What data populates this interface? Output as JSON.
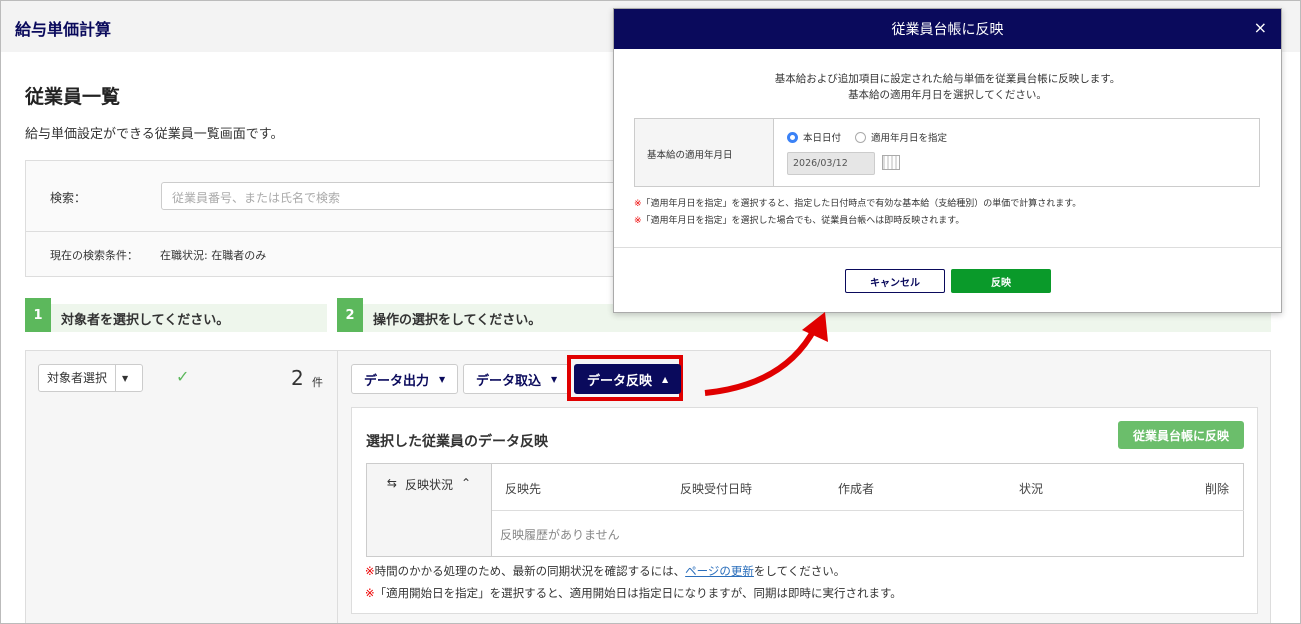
{
  "app_title": "給与単価計算",
  "page": {
    "title": "従業員一覧",
    "description": "給与単価設定ができる従業員一覧画面です。"
  },
  "search": {
    "label": "検索：",
    "placeholder": "従業員番号、または氏名で検索",
    "condition_label": "現在の検索条件：",
    "condition_value": "在職状況: 在職者のみ"
  },
  "steps": [
    {
      "num": "1",
      "label": "対象者を選択してください。"
    },
    {
      "num": "2",
      "label": "操作の選択をしてください。"
    }
  ],
  "selector": {
    "label": "対象者選択",
    "count": "2",
    "unit": "件"
  },
  "actions": [
    {
      "label": "データ出力"
    },
    {
      "label": "データ取込"
    },
    {
      "label": "データ反映"
    }
  ],
  "reflect": {
    "title": "選択した従業員のデータ反映",
    "button": "従業員台帳に反映",
    "status_toggle": "反映状況",
    "columns": [
      "反映先",
      "反映受付日時",
      "作成者",
      "状況",
      "削除"
    ],
    "empty": "反映履歴がありません",
    "note1_pre": "時間のかかる処理のため、最新の同期状況を確認するには、",
    "note1_link": "ページの更新",
    "note1_post": "をしてください。",
    "note2": "「適用開始日を指定」を選択すると、適用開始日は指定日になりますが、同期は即時に実行されます。",
    "mark": "※"
  },
  "modal": {
    "title": "従業員台帳に反映",
    "close": "×",
    "desc1": "基本給および追加項目に設定された給与単価を従業員台帳に反映します。",
    "desc2": "基本給の適用年月日を選択してください。",
    "field_label": "基本給の適用年月日",
    "radio_today": "本日日付",
    "radio_specify": "適用年月日を指定",
    "date": "2026/03/12",
    "note1": "「適用年月日を指定」を選択すると、指定した日付時点で有効な基本給（支給種別）の単価で計算されます。",
    "note2": "「適用年月日を指定」を選択した場合でも、従業員台帳へは即時反映されます。",
    "cancel": "キャンセル",
    "apply": "反映"
  },
  "colors": {
    "navy": "#0a0a5c",
    "green": "#5cb85c",
    "highlight": "#e00000"
  }
}
